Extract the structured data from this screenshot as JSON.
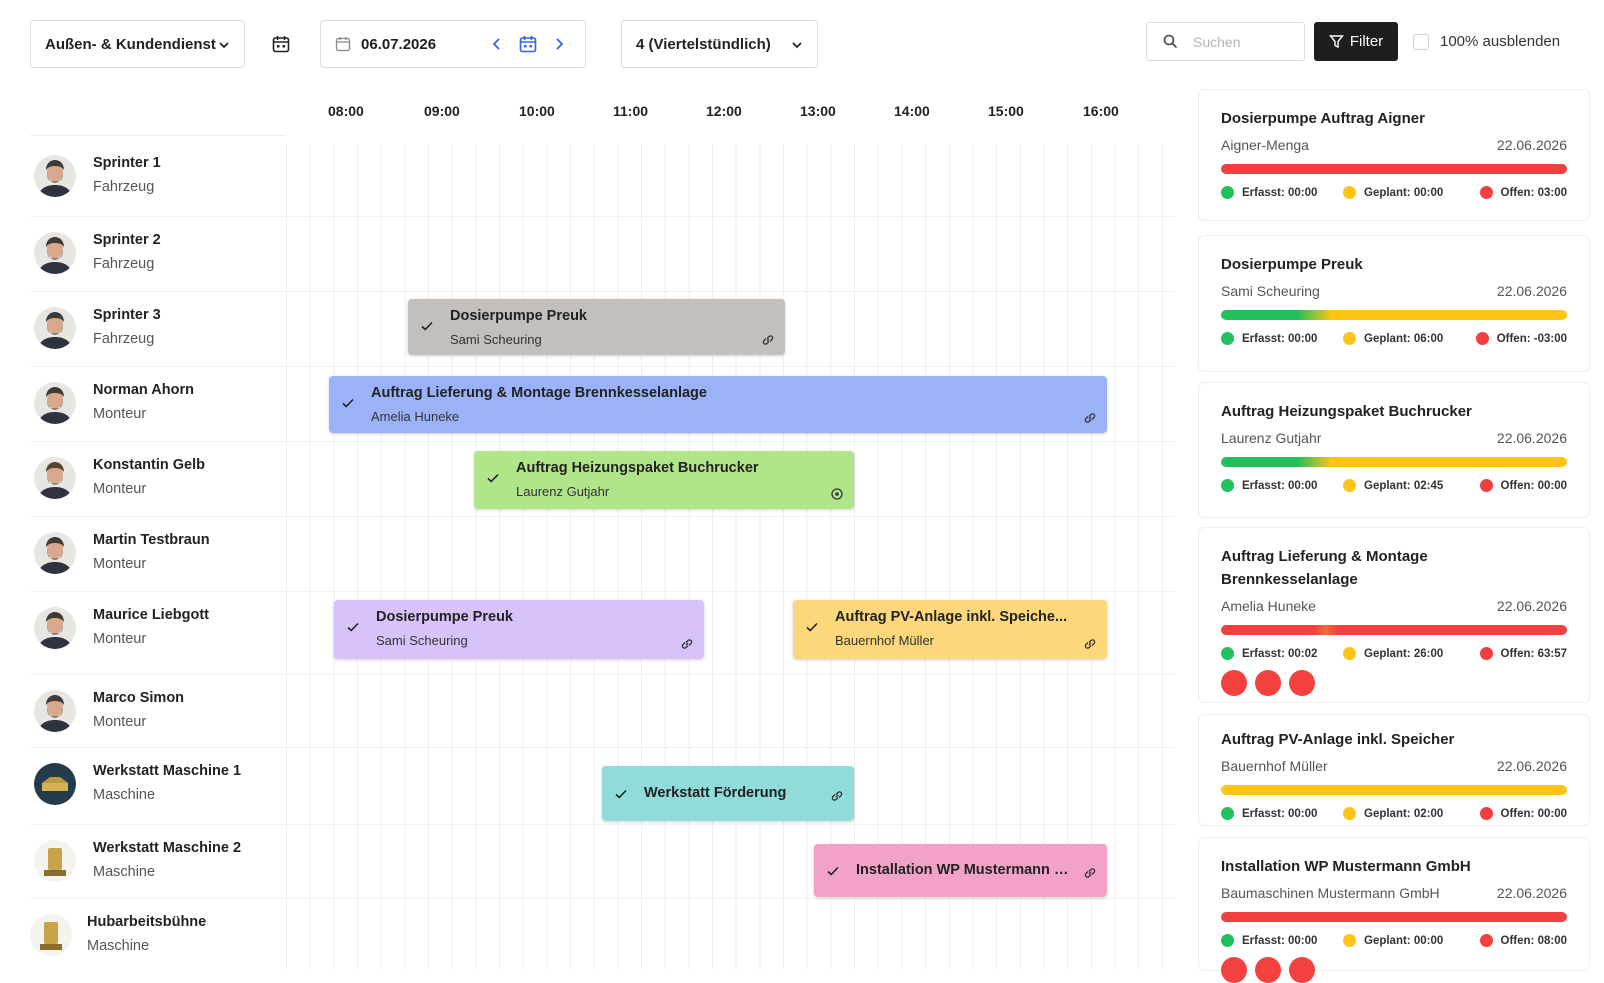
{
  "toolbar": {
    "department": "Außen- & Kundendienst",
    "date": "06.07.2026",
    "interval": "4 (Viertelstündlich)",
    "search_placeholder": "Suchen",
    "filter_label": "Filter",
    "hide_label": "100% ausblenden"
  },
  "hours": [
    "08:00",
    "09:00",
    "10:00",
    "11:00",
    "12:00",
    "13:00",
    "14:00",
    "15:00",
    "16:00"
  ],
  "resources": [
    {
      "name": "Sprinter 1",
      "type": "Fahrzeug"
    },
    {
      "name": "Sprinter 2",
      "type": "Fahrzeug"
    },
    {
      "name": "Sprinter 3",
      "type": "Fahrzeug"
    },
    {
      "name": "Norman Ahorn",
      "type": "Monteur"
    },
    {
      "name": "Konstantin Gelb",
      "type": "Monteur"
    },
    {
      "name": "Martin Testbraun",
      "type": "Monteur"
    },
    {
      "name": "Maurice Liebgott",
      "type": "Monteur"
    },
    {
      "name": "Marco Simon",
      "type": "Monteur"
    },
    {
      "name": "Werkstatt Maschine 1",
      "type": "Maschine"
    },
    {
      "name": "Werkstatt Maschine 2",
      "type": "Maschine"
    },
    {
      "name": "Hubarbeitsbühne",
      "type": "Maschine"
    }
  ],
  "events": [
    {
      "title": "Dosierpumpe Preuk",
      "sub": "Sami Scheuring",
      "color": "#c2bfbc",
      "icon": "link-icon"
    },
    {
      "title": "Auftrag Lieferung & Montage Brennkesselanlage",
      "sub": "Amelia Huneke",
      "color": "#9bb2f8",
      "icon": "link-icon"
    },
    {
      "title": "Auftrag Heizungspaket Buchrucker",
      "sub": "Laurenz Gutjahr",
      "color": "#b1e58a",
      "icon": "target-icon"
    },
    {
      "title": "Dosierpumpe Preuk",
      "sub": "Sami Scheuring",
      "color": "#d7c2fa",
      "icon": "link-icon"
    },
    {
      "title": "Auftrag PV-Anlage inkl. Speiche...",
      "sub": "Bauernhof Müller",
      "color": "#fcd77b",
      "icon": "link-icon"
    },
    {
      "title": "Werkstatt Förderung",
      "sub": "",
      "color": "#8fdcd9",
      "icon": "link-icon"
    },
    {
      "title": "Installation WP Mustermann GmbH",
      "sub": "",
      "color": "#f2a2c7",
      "icon": "link-icon"
    }
  ],
  "cards": [
    {
      "title": "Dosierpumpe Auftrag Aigner",
      "customer": "Aigner-Menga",
      "date": "22.06.2026",
      "erfasst": "Erfasst: 00:00",
      "geplant": "Geplant: 00:00",
      "offen": "Offen: 03:00",
      "bar": "red",
      "bubbles": 0
    },
    {
      "title": "Dosierpumpe Preuk",
      "customer": "Sami Scheuring",
      "date": "22.06.2026",
      "erfasst": "Erfasst: 00:00",
      "geplant": "Geplant: 06:00",
      "offen": "Offen: -03:00",
      "bar": "green-yellow",
      "bubbles": 0
    },
    {
      "title": "Auftrag Heizungspaket Buchrucker",
      "customer": "Laurenz Gutjahr",
      "date": "22.06.2026",
      "erfasst": "Erfasst: 00:00",
      "geplant": "Geplant: 02:45",
      "offen": "Offen: 00:00",
      "bar": "green-yellow",
      "bubbles": 0
    },
    {
      "title": "Auftrag Lieferung & Montage Brennkesselanlage",
      "customer": "Amelia Huneke",
      "date": "22.06.2026",
      "erfasst": "Erfasst: 00:02",
      "geplant": "Geplant: 26:00",
      "offen": "Offen: 63:57",
      "bar": "red",
      "bubbles": 3
    },
    {
      "title": "Auftrag PV-Anlage inkl. Speicher",
      "customer": "Bauernhof Müller",
      "date": "22.06.2026",
      "erfasst": "Erfasst: 00:00",
      "geplant": "Geplant: 02:00",
      "offen": "Offen: 00:00",
      "bar": "yellow",
      "bubbles": 0
    },
    {
      "title": "Installation WP Mustermann GmbH",
      "customer": "Baumaschinen Mustermann GmbH",
      "date": "22.06.2026",
      "erfasst": "Erfasst: 00:00",
      "geplant": "Geplant: 00:00",
      "offen": "Offen: 08:00",
      "bar": "red",
      "bubbles": 3
    }
  ],
  "colors": {
    "green": "#20c05c",
    "yellow": "#ffc414",
    "red": "#f23f3f"
  }
}
